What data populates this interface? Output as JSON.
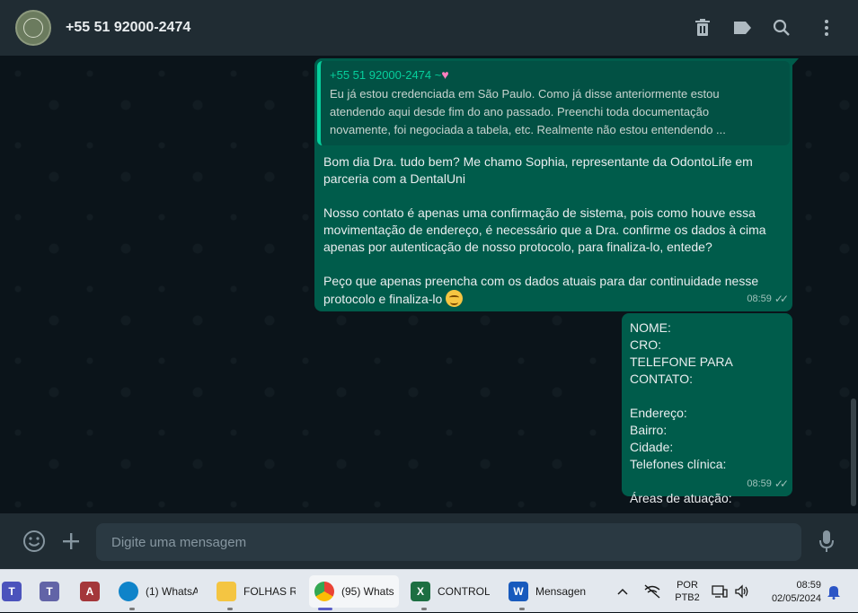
{
  "header": {
    "contact_name": "+55 51 92000-2474",
    "icons": [
      "trash-icon",
      "label-icon",
      "search-icon",
      "more-vertical-icon"
    ]
  },
  "messages": [
    {
      "type": "outgoing",
      "quote": {
        "author": "+55 51 92000-2474",
        "author_suffix": "~",
        "text": "Eu já estou credenciada em São Paulo. Como já disse anteriormente estou\natendendo aqui desde fim do ano passado. Preenchi toda documentação\nnovamente, foi negociada a tabela, etc. Realmente não estou entendendo ..."
      },
      "text": "Bom dia Dra. tudo bem? Me chamo Sophia, representante da OdontoLife em\nparceria com a DentalUni\n\nNosso contato é apenas uma confirmação de sistema, pois como houve essa\nmovimentação de endereço, é necessário que a Dra. confirme os dados à cima\napenas por autenticação de nosso protocolo, para finaliza-lo, entede?\n\nPeço que apenas preencha com os dados atuais para dar continuidade nesse\nprotocolo e finaliza-lo",
      "time": "08:59"
    },
    {
      "type": "outgoing",
      "text": "NOME:\nCRO:\nTELEFONE PARA CONTATO:\n\nEndereço:\nBairro:\nCidade:\nTelefones clínica:\n\nÁreas de atuação:",
      "time": "08:59"
    }
  ],
  "composer": {
    "placeholder": "Digite uma mensagem"
  },
  "taskbar": {
    "apps": [
      {
        "name": "teams-classic",
        "label": ""
      },
      {
        "name": "teams-new",
        "label": ""
      },
      {
        "name": "access",
        "label": ""
      },
      {
        "name": "edge",
        "label": "(1) WhatsA"
      },
      {
        "name": "file-explorer",
        "label": "FOLHAS R("
      },
      {
        "name": "chrome",
        "label": "(95) Whats"
      },
      {
        "name": "excel",
        "label": "CONTROLI"
      },
      {
        "name": "word",
        "label": "Mensagen"
      }
    ],
    "language": "POR",
    "keyboard": "PTB2",
    "time": "08:59",
    "date": "02/05/2024"
  },
  "colors": {
    "bubble_outgoing": "#005c4b",
    "header_bg": "#202c33",
    "chat_bg": "#0b141a",
    "accent": "#06cf9c"
  }
}
